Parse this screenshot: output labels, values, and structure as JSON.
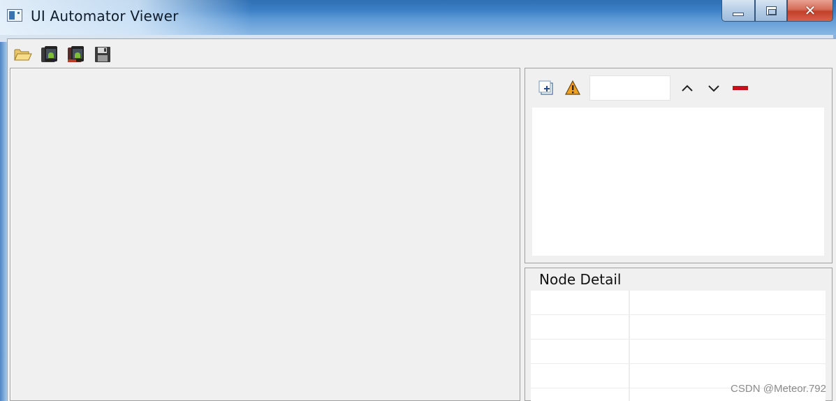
{
  "window": {
    "title": "UI Automator Viewer",
    "controls": [
      "minimize",
      "maximize",
      "close"
    ]
  },
  "toolbar": {
    "buttons": [
      {
        "icon": "open-folder-icon"
      },
      {
        "icon": "device-screenshot-icon"
      },
      {
        "icon": "device-screenshot-compressed-icon"
      },
      {
        "icon": "save-icon"
      }
    ]
  },
  "tree_panel": {
    "toolbar": [
      {
        "icon": "expand-all-icon"
      },
      {
        "icon": "warning-icon"
      },
      {
        "icon": "search-input"
      },
      {
        "icon": "chevron-up-icon"
      },
      {
        "icon": "chevron-down-icon"
      },
      {
        "icon": "clear-search-icon"
      }
    ],
    "search_value": ""
  },
  "node_detail": {
    "title": "Node Detail",
    "rows": 5
  },
  "watermark": "CSDN @Meteor.792",
  "colors": {
    "title_bar": "#3d80c6",
    "close_button": "#c2402a",
    "panel_bg": "#f0f0f0",
    "clear_icon": "#c8101a",
    "warning_icon": "#f0a020"
  }
}
